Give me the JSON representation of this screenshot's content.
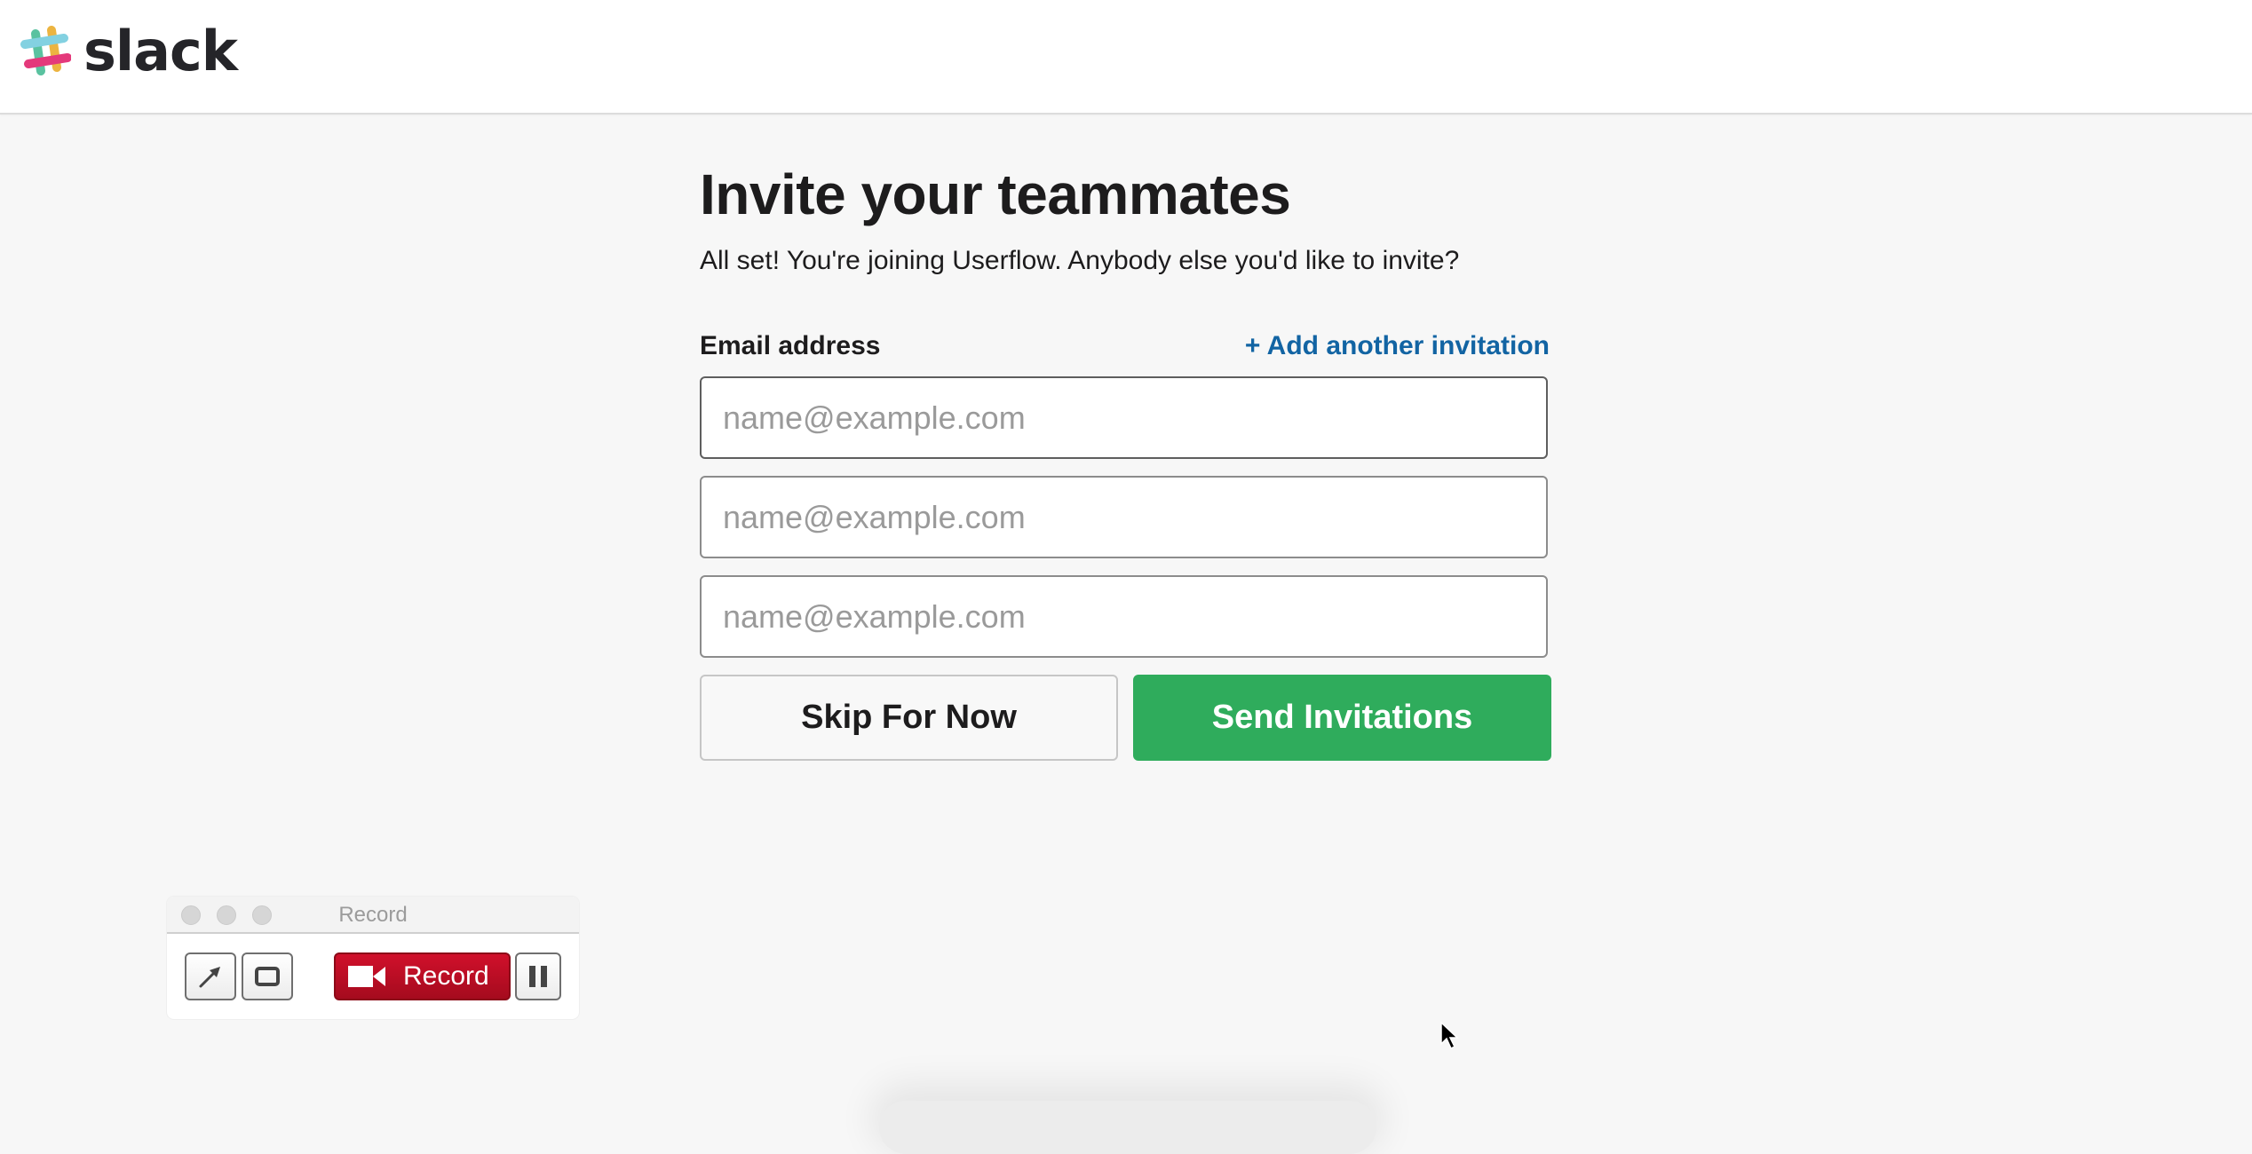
{
  "header": {
    "logo_text": "slack",
    "logo_icon": "slack-hash-logo-icon"
  },
  "form": {
    "title": "Invite your teammates",
    "subtitle": "All set! You're joining Userflow. Anybody else you'd like to invite?",
    "email_label": "Email address",
    "add_link": "+ Add another invitation",
    "inputs": [
      {
        "value": "",
        "placeholder": "name@example.com",
        "focused": true
      },
      {
        "value": "",
        "placeholder": "name@example.com",
        "focused": false
      },
      {
        "value": "",
        "placeholder": "name@example.com",
        "focused": false
      }
    ],
    "skip_label": "Skip For Now",
    "send_label": "Send Invitations",
    "colors": {
      "link": "#1264a3",
      "send_button": "#2fac5c"
    }
  },
  "record_widget": {
    "title": "Record",
    "record_label": "Record",
    "tools": [
      "arrow-icon",
      "rectangle-icon"
    ],
    "pause_icon": "pause-icon",
    "camera_icon": "video-camera-icon",
    "colors": {
      "record_button": "#c20e27"
    }
  }
}
